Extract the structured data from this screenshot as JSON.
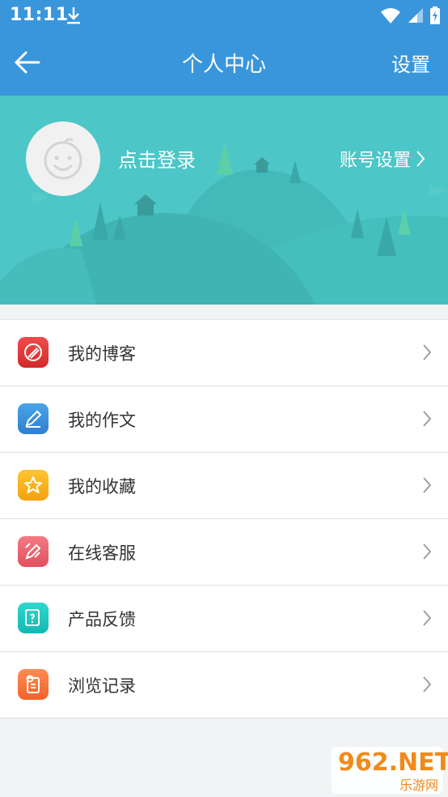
{
  "status_bar": {
    "time": "11:11"
  },
  "header": {
    "title": "个人中心",
    "settings_label": "设置"
  },
  "profile": {
    "login_text": "点击登录",
    "account_settings": "账号设置"
  },
  "menu": [
    {
      "label": "我的博客",
      "icon": "blog-icon",
      "color": "#e53935"
    },
    {
      "label": "我的作文",
      "icon": "essay-pencil-icon",
      "color": "#3b8fd9"
    },
    {
      "label": "我的收藏",
      "icon": "star-icon",
      "color": "#f8b21b"
    },
    {
      "label": "在线客服",
      "icon": "customer-service-icon",
      "color": "#ee6672"
    },
    {
      "label": "产品反馈",
      "icon": "feedback-icon",
      "color": "#19c9c2"
    },
    {
      "label": "浏览记录",
      "icon": "history-icon",
      "color": "#ff7a3d"
    }
  ],
  "watermark": {
    "brand": "962.NET",
    "sub": "乐游网"
  },
  "colors": {
    "primary": "#3a96db",
    "banner": "#4cc6c6"
  }
}
